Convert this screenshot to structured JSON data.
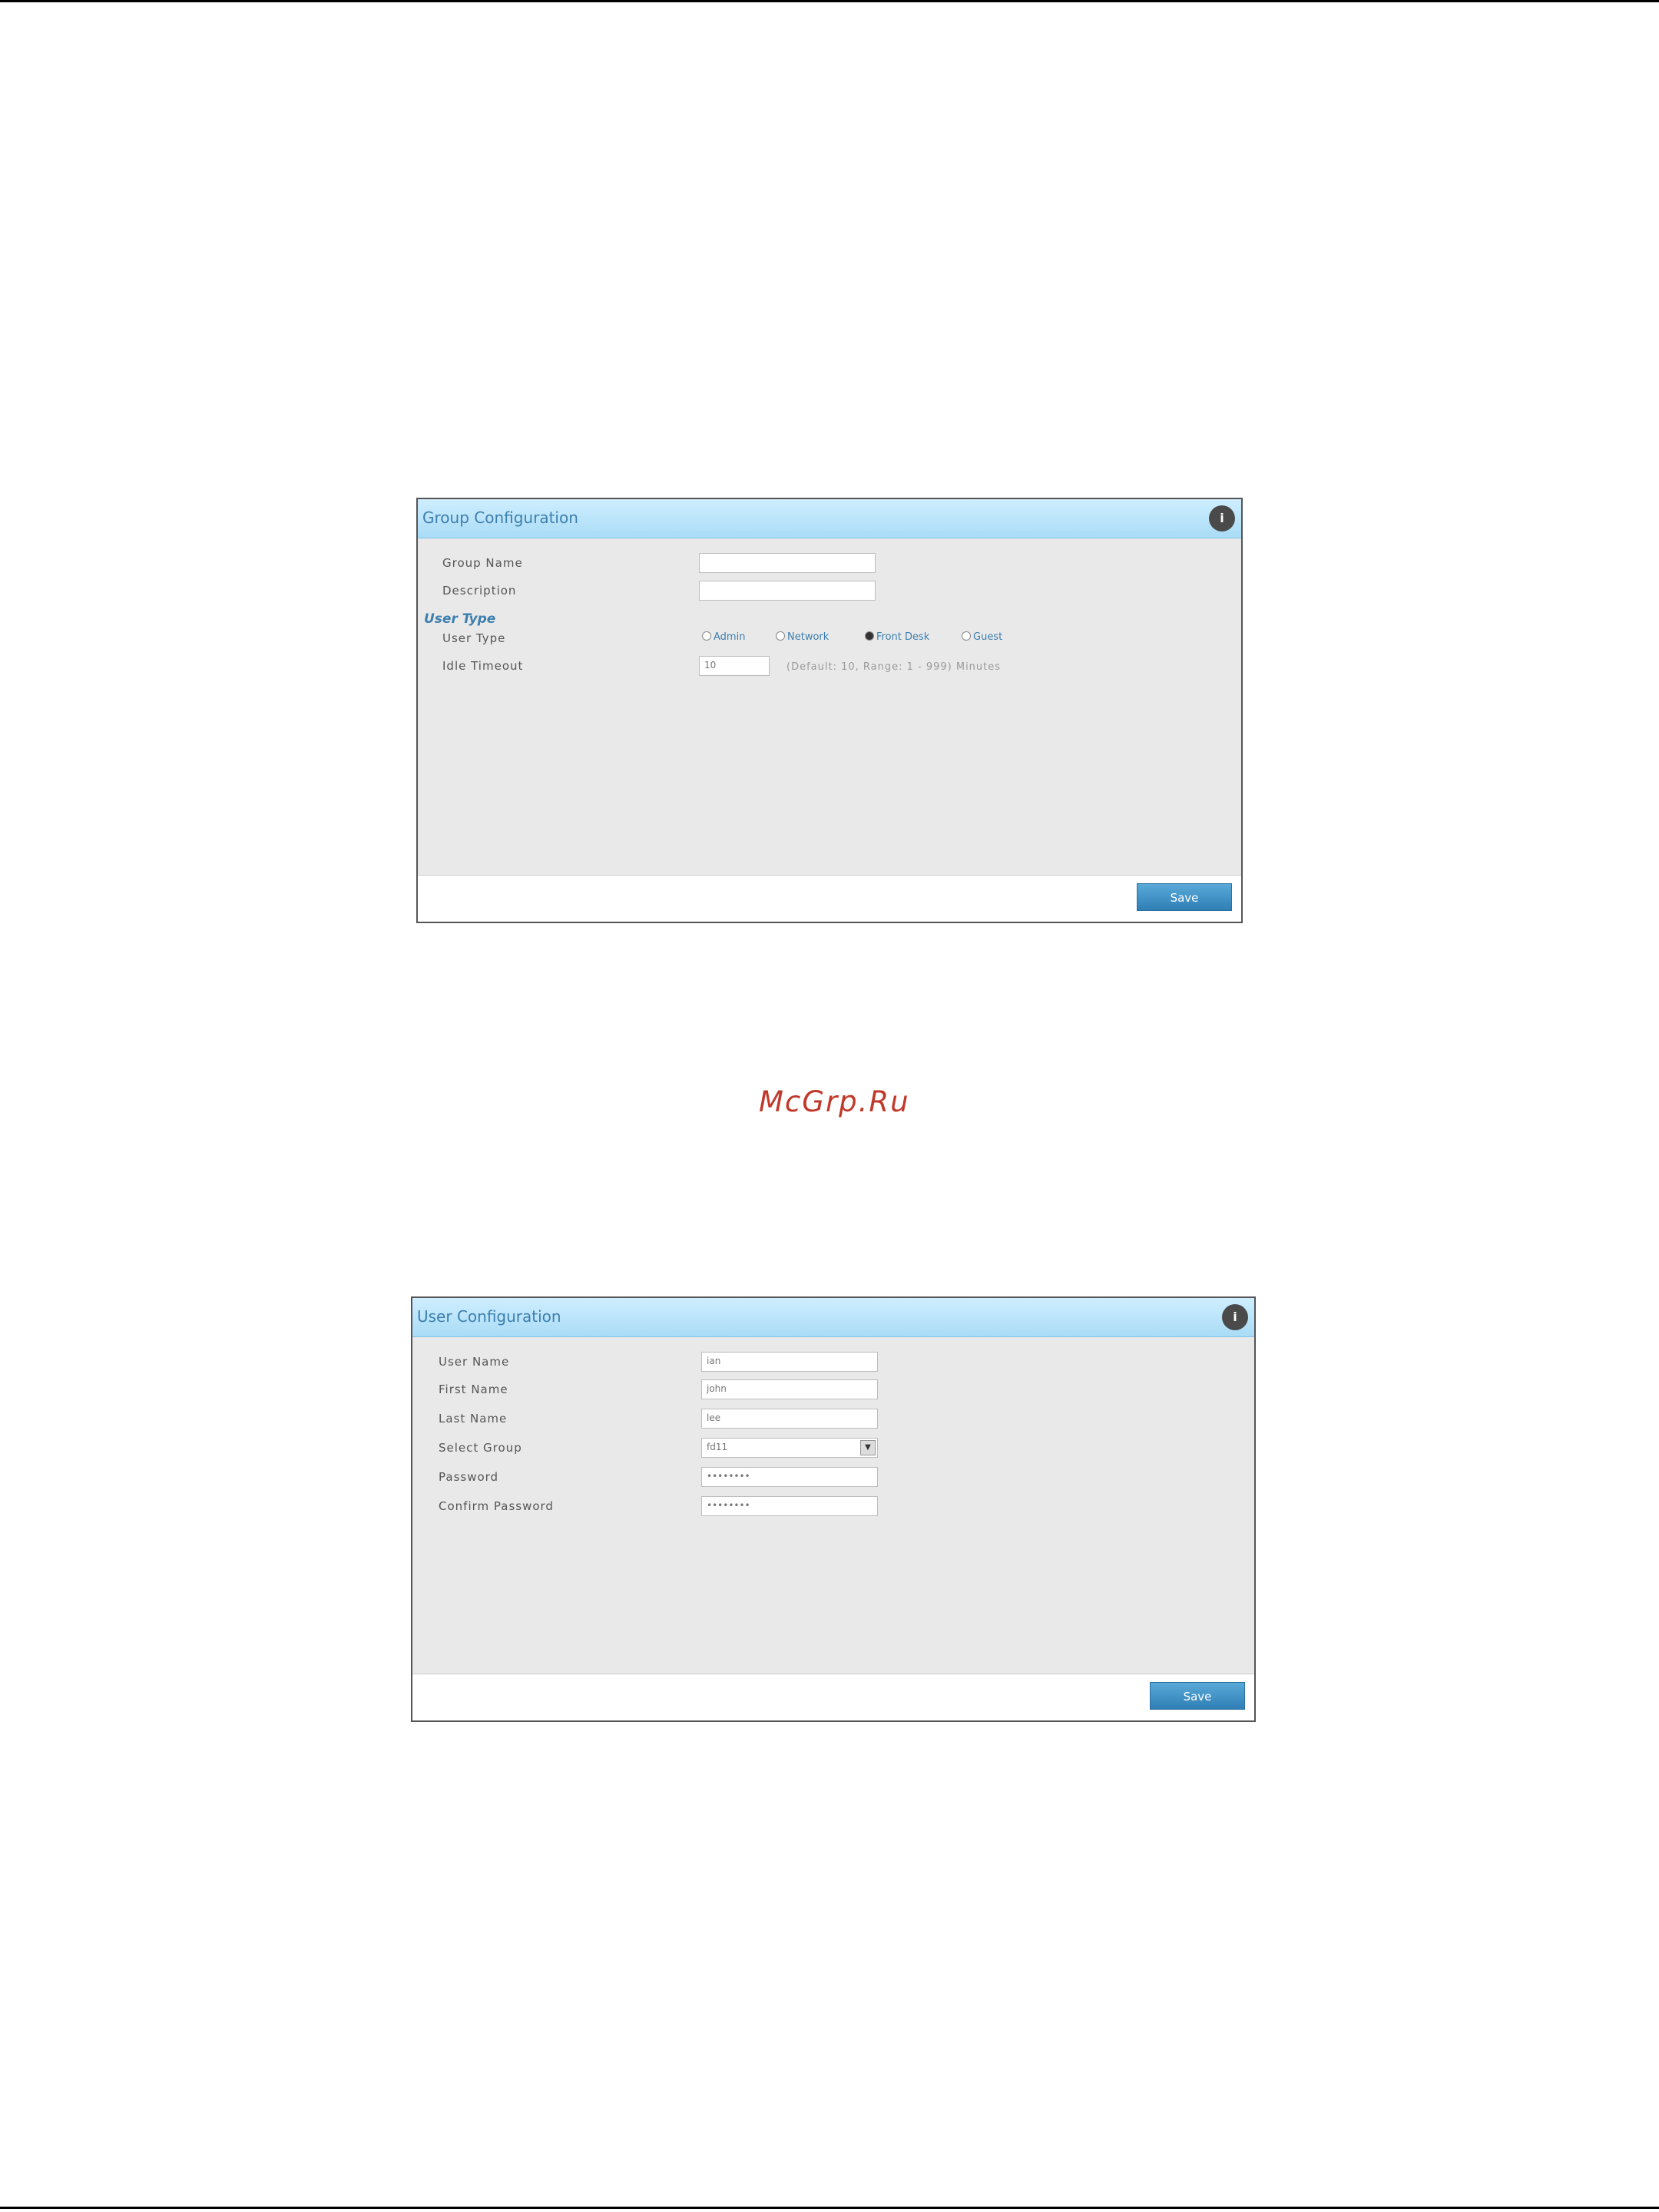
{
  "watermark": "McGrp.Ru",
  "group_config": {
    "title": "Group Configuration",
    "help_icon": "i",
    "fields": {
      "group_name_label": "Group Name",
      "group_name_value": "",
      "description_label": "Description",
      "description_value": "",
      "section_user_type": "User Type",
      "user_type_label": "User Type",
      "user_type_options": [
        "Admin",
        "Network",
        "Front Desk",
        "Guest"
      ],
      "user_type_selected": "Front Desk",
      "idle_timeout_label": "Idle Timeout",
      "idle_timeout_value": "10",
      "idle_timeout_hint": "(Default: 10, Range: 1 - 999) Minutes"
    },
    "save_label": "Save"
  },
  "user_config": {
    "title": "User Configuration",
    "help_icon": "i",
    "fields": {
      "user_name_label": "User Name",
      "user_name_value": "ian",
      "first_name_label": "First Name",
      "first_name_value": "john",
      "last_name_label": "Last Name",
      "last_name_value": "lee",
      "select_group_label": "Select Group",
      "select_group_value": "fd11",
      "password_label": "Password",
      "password_value": "••••••••",
      "confirm_password_label": "Confirm Password",
      "confirm_password_value": "••••••••"
    },
    "save_label": "Save"
  }
}
